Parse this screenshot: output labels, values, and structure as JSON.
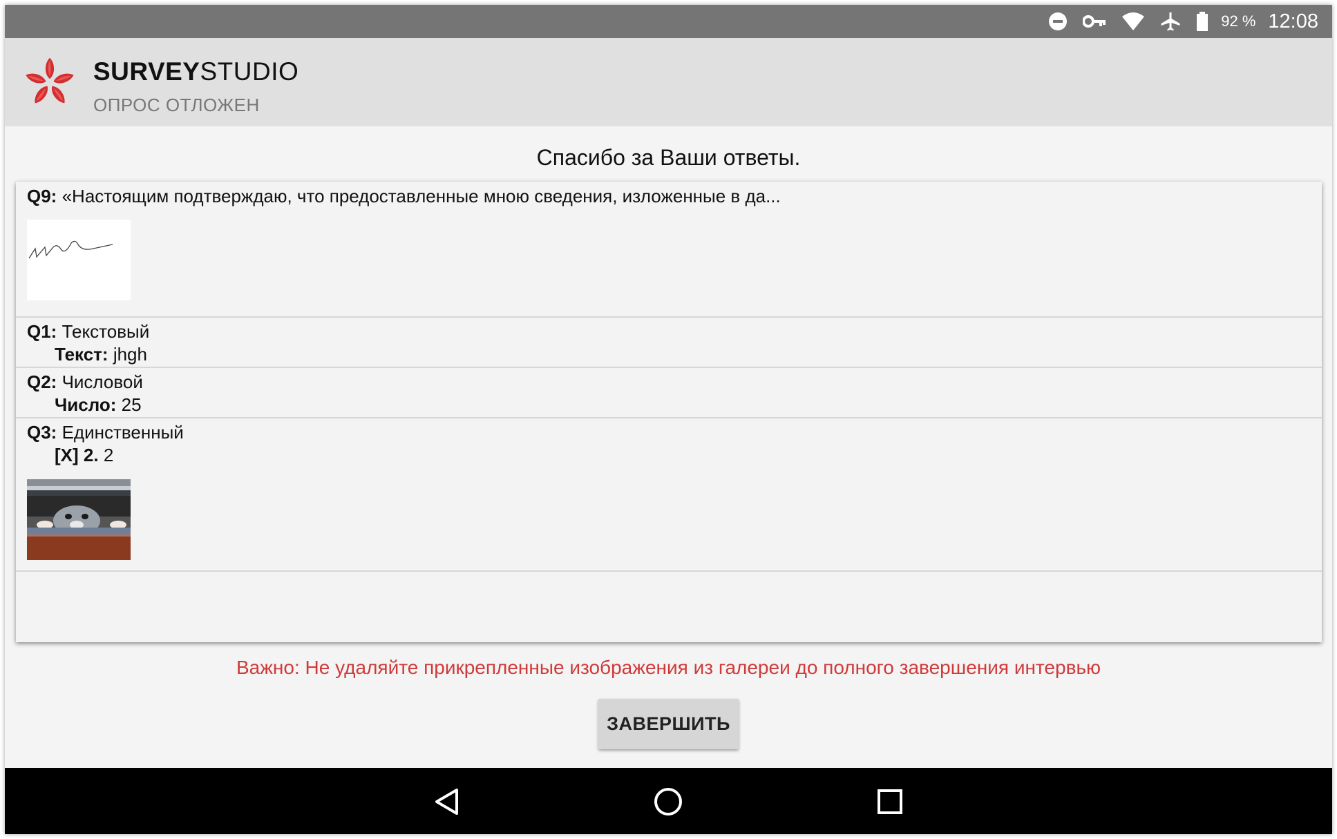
{
  "status_bar": {
    "icons": [
      "do-not-disturb-icon",
      "vpn-key-icon",
      "wifi-icon",
      "airplane-icon",
      "battery-icon"
    ],
    "battery_text": "92 %",
    "time": "12:08"
  },
  "app_bar": {
    "brand_bold": "SURVEY",
    "brand_regular": "STUDIO",
    "subtitle": "ОПРОС ОТЛОЖЕН",
    "logo_color": "#d32f2f"
  },
  "thanks_text": "Спасибо за Ваши ответы.",
  "answers": [
    {
      "id": "Q9:",
      "question": "«Настоящим подтверждаю, что предоставленные мною сведения, изложенные в да...",
      "attachment": "signature-image"
    },
    {
      "id": "Q1:",
      "question": "Текстовый",
      "answer_label": "Текст:",
      "answer_value": "jhgh"
    },
    {
      "id": "Q2:",
      "question": "Числовой",
      "answer_label": "Число:",
      "answer_value": "25"
    },
    {
      "id": "Q3:",
      "question": "Единственный",
      "answer_label": "[X] 2.",
      "answer_value": "2",
      "attachment": "cat-photo-image"
    }
  ],
  "warning": "Важно: Не удаляйте прикрепленные изображения из галереи до полного завершения интервью",
  "finish_button": "ЗАВЕРШИТЬ",
  "nav_bar": {
    "icons": [
      "back-icon",
      "home-icon",
      "recents-icon"
    ]
  },
  "colors": {
    "status_bar": "#757575",
    "app_bar": "#e0e0e0",
    "warning": "#d03a3a",
    "nav_bar": "#000000"
  }
}
